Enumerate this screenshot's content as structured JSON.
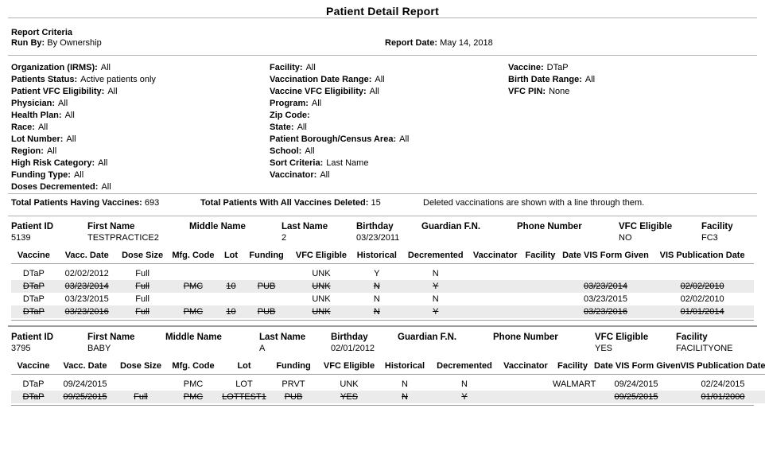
{
  "report": {
    "title": "Patient Detail Report",
    "criteria_heading": "Report Criteria",
    "run_by_label": "Run By:",
    "run_by_value": "By Ownership",
    "report_date_label": "Report Date:",
    "report_date_value": "May 14, 2018"
  },
  "criteria": {
    "column1": [
      {
        "label": "Organization (IRMS):",
        "value": "All"
      },
      {
        "label": "Patients Status:",
        "value": "Active patients only"
      },
      {
        "label": "Patient VFC Eligibility:",
        "value": "All"
      },
      {
        "label": "Physician:",
        "value": "All"
      },
      {
        "label": "Health Plan:",
        "value": "All"
      },
      {
        "label": "Race:",
        "value": "All"
      },
      {
        "label": "Lot Number:",
        "value": "All"
      },
      {
        "label": "Region:",
        "value": "All"
      },
      {
        "label": "High Risk Category:",
        "value": "All"
      },
      {
        "label": "Funding Type:",
        "value": "All"
      },
      {
        "label": "Doses Decremented:",
        "value": "All"
      }
    ],
    "column2": [
      {
        "label": "Facility:",
        "value": "All"
      },
      {
        "label": "Vaccination Date Range:",
        "value": "All"
      },
      {
        "label": "Vaccine VFC Eligibility:",
        "value": "All"
      },
      {
        "label": "Program:",
        "value": "All"
      },
      {
        "label": "Zip Code:",
        "value": ""
      },
      {
        "label": "State:",
        "value": "All"
      },
      {
        "label": "Patient Borough/Census Area:",
        "value": "All"
      },
      {
        "label": "School:",
        "value": "All"
      },
      {
        "label": "Sort Criteria:",
        "value": "Last Name"
      },
      {
        "label": "Vaccinator:",
        "value": "All"
      }
    ],
    "column3": [
      {
        "label": "Vaccine:",
        "value": "DTaP"
      },
      {
        "label": "Birth Date Range:",
        "value": "All"
      },
      {
        "label": "VFC PIN:",
        "value": "None"
      }
    ]
  },
  "totals": {
    "having_label": "Total Patients Having Vaccines:",
    "having_value": "693",
    "deleted_label": "Total Patients With All Vaccines Deleted:",
    "deleted_value": "15",
    "note": "Deleted vaccinations are shown with a line through them."
  },
  "patient_columns": [
    "Patient ID",
    "First Name",
    "Middle Name",
    "Last Name",
    "Birthday",
    "Guardian F.N.",
    "Phone Number",
    "VFC Eligible",
    "Facility"
  ],
  "vaccine_columns": [
    "Vaccine",
    "Vacc. Date",
    "Dose Size",
    "Mfg. Code",
    "Lot",
    "Funding",
    "VFC Eligible",
    "Historical",
    "Decremented",
    "Vaccinator",
    "Facility",
    "Date VIS Form Given",
    "VIS Publication Date"
  ],
  "patients": [
    {
      "patient_id": "5139",
      "first_name": "TESTPRACTICE2",
      "middle_name": "",
      "last_name": "2",
      "birthday": "03/23/2011",
      "guardian_fn": "",
      "phone_number": "",
      "vfc_eligible": "NO",
      "facility": "FC3",
      "vaccinations": [
        {
          "vaccine": "DTaP",
          "vacc_date": "02/02/2012",
          "dose_size": "Full",
          "mfg_code": "",
          "lot": "",
          "funding": "",
          "vfc_eligible": "UNK",
          "historical": "Y",
          "decremented": "N",
          "vaccinator": "",
          "facility": "",
          "date_vis_form_given": "",
          "vis_publication_date": ""
        },
        {
          "vaccine": "DTaP",
          "vacc_date": "03/23/2014",
          "dose_size": "Full",
          "mfg_code": "PMC",
          "lot": "10",
          "funding": "PUB",
          "vfc_eligible": "UNK",
          "historical": "N",
          "decremented": "Y",
          "vaccinator": "",
          "facility": "",
          "date_vis_form_given": "03/23/2014",
          "vis_publication_date": "02/02/2010"
        },
        {
          "vaccine": "DTaP",
          "vacc_date": "03/23/2015",
          "dose_size": "Full",
          "mfg_code": "",
          "lot": "",
          "funding": "",
          "vfc_eligible": "UNK",
          "historical": "N",
          "decremented": "N",
          "vaccinator": "",
          "facility": "",
          "date_vis_form_given": "03/23/2015",
          "vis_publication_date": "02/02/2010"
        },
        {
          "vaccine": "DTaP",
          "vacc_date": "03/23/2016",
          "dose_size": "Full",
          "mfg_code": "PMC",
          "lot": "10",
          "funding": "PUB",
          "vfc_eligible": "UNK",
          "historical": "N",
          "decremented": "Y",
          "vaccinator": "",
          "facility": "",
          "date_vis_form_given": "03/23/2016",
          "vis_publication_date": "01/01/2014"
        }
      ]
    },
    {
      "patient_id": "3795",
      "first_name": "BABY",
      "middle_name": "",
      "last_name": "A",
      "birthday": "02/01/2012",
      "guardian_fn": "",
      "phone_number": "",
      "vfc_eligible": "YES",
      "facility": "FACILITYONE",
      "vaccinations": [
        {
          "vaccine": "DTaP",
          "vacc_date": "09/24/2015",
          "dose_size": "",
          "mfg_code": "PMC",
          "lot": "LOT",
          "funding": "PRVT",
          "vfc_eligible": "UNK",
          "historical": "N",
          "decremented": "N",
          "vaccinator": "",
          "facility": "WALMART",
          "date_vis_form_given": "09/24/2015",
          "vis_publication_date": "02/24/2015"
        },
        {
          "vaccine": "DTaP",
          "vacc_date": "09/25/2015",
          "dose_size": "Full",
          "mfg_code": "PMC",
          "lot": "LOTTEST1",
          "funding": "PUB",
          "vfc_eligible": "YES",
          "historical": "N",
          "decremented": "Y",
          "vaccinator": "",
          "facility": "",
          "date_vis_form_given": "09/25/2015",
          "vis_publication_date": "01/01/2000"
        }
      ]
    }
  ],
  "colors": {
    "stripe": "#ebebeb",
    "rule": "#9a9a9a",
    "text": "#000000"
  }
}
